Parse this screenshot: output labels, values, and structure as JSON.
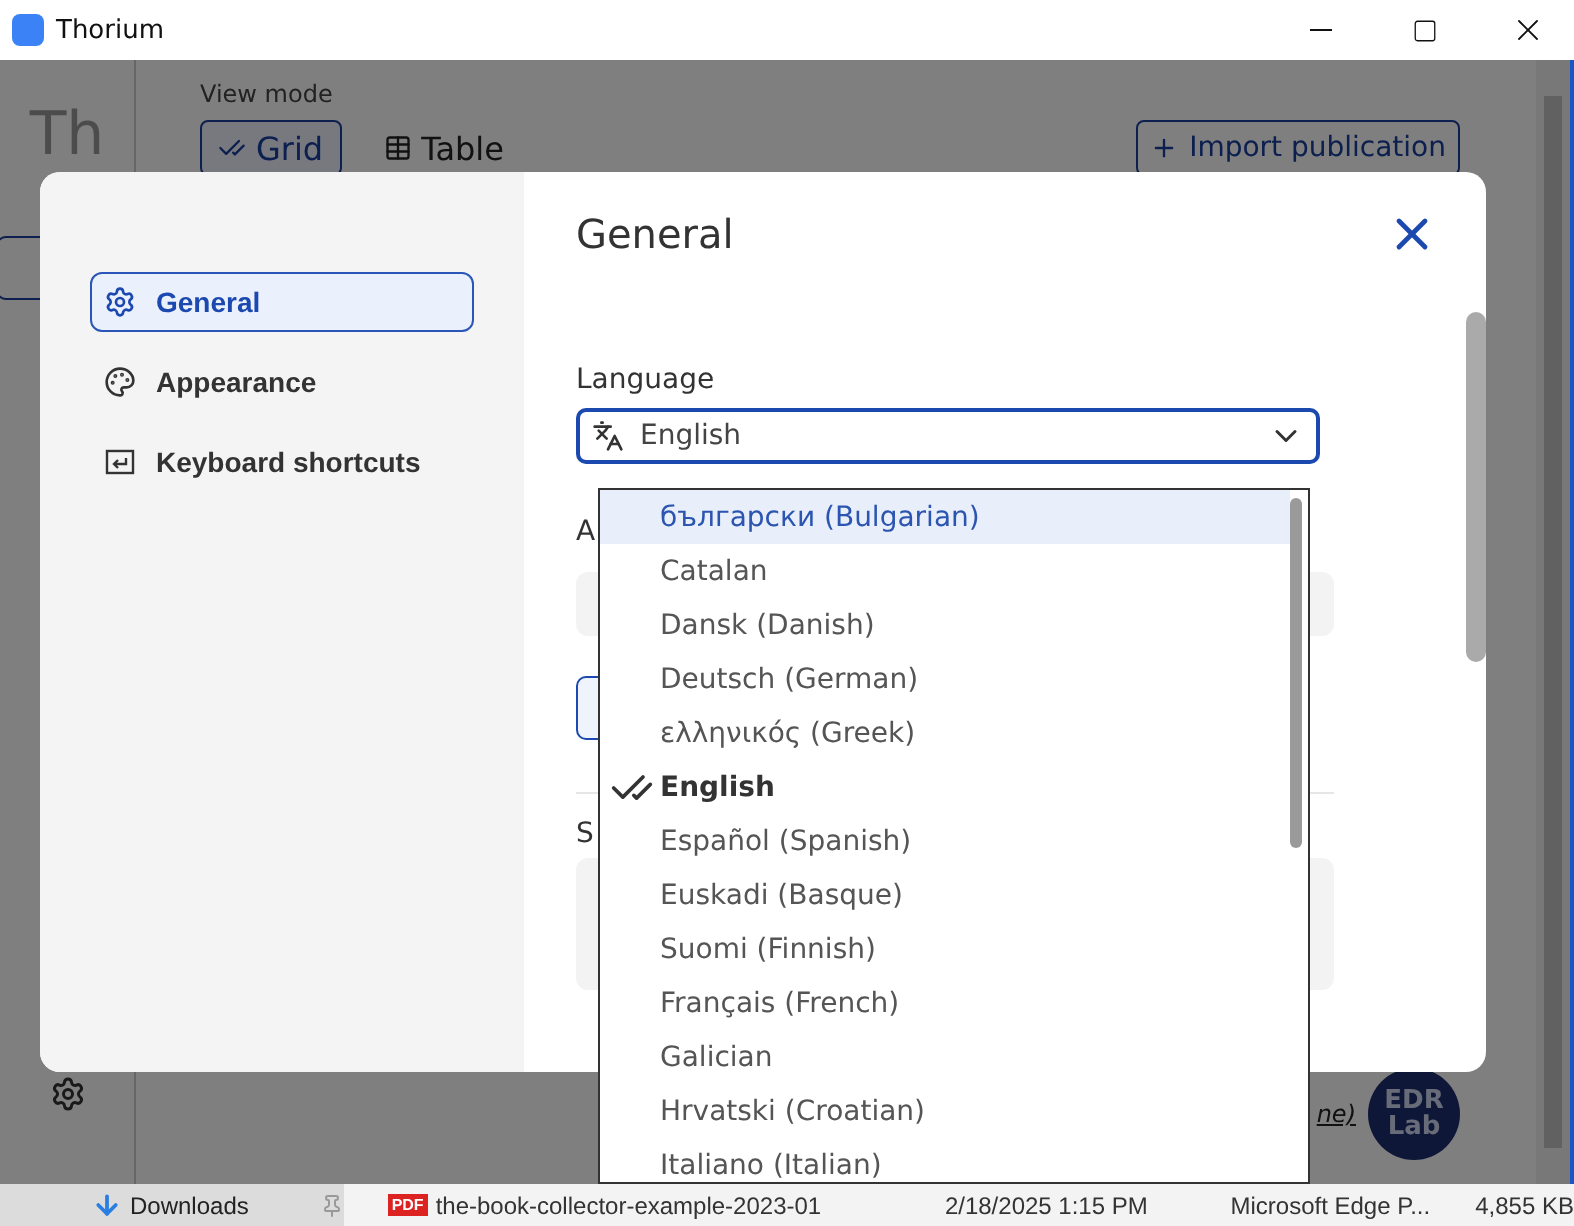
{
  "window": {
    "title": "Thorium"
  },
  "library": {
    "logo": "Th",
    "view_mode_label": "View mode",
    "view_modes": [
      {
        "label": "Grid",
        "selected": true
      },
      {
        "label": "Table",
        "selected": false
      }
    ],
    "import_button": "Import publication",
    "footer_link": "ne)",
    "brand_logo": [
      "EDR",
      "Lab"
    ]
  },
  "settings": {
    "nav": [
      {
        "label": "General",
        "selected": true
      },
      {
        "label": "Appearance",
        "selected": false
      },
      {
        "label": "Keyboard shortcuts",
        "selected": false
      }
    ],
    "title": "General",
    "language": {
      "label": "Language",
      "value": "English"
    },
    "covered_labels": [
      "A",
      "S"
    ],
    "language_options": [
      {
        "label": "български (Bulgarian)",
        "highlighted": true,
        "selected": false
      },
      {
        "label": "Catalan",
        "highlighted": false,
        "selected": false
      },
      {
        "label": "Dansk (Danish)",
        "highlighted": false,
        "selected": false
      },
      {
        "label": "Deutsch (German)",
        "highlighted": false,
        "selected": false
      },
      {
        "label": "ελληνικός (Greek)",
        "highlighted": false,
        "selected": false
      },
      {
        "label": "English",
        "highlighted": false,
        "selected": true
      },
      {
        "label": "Español (Spanish)",
        "highlighted": false,
        "selected": false
      },
      {
        "label": "Euskadi (Basque)",
        "highlighted": false,
        "selected": false
      },
      {
        "label": "Suomi (Finnish)",
        "highlighted": false,
        "selected": false
      },
      {
        "label": "Français (French)",
        "highlighted": false,
        "selected": false
      },
      {
        "label": "Galician",
        "highlighted": false,
        "selected": false
      },
      {
        "label": "Hrvatski (Croatian)",
        "highlighted": false,
        "selected": false
      },
      {
        "label": "Italiano (Italian)",
        "highlighted": false,
        "selected": false
      }
    ]
  },
  "file_row": {
    "folder": "Downloads",
    "file_badge": "PDF",
    "file": "the-book-collector-example-2023-01",
    "date": "2/18/2025 1:15 PM",
    "type": "Microsoft Edge P...",
    "size": "4,855 KB"
  }
}
